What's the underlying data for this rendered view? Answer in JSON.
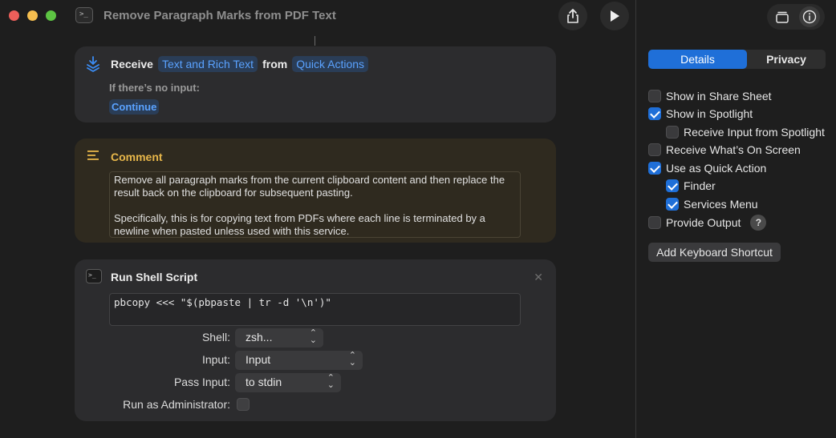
{
  "window": {
    "title": "Remove Paragraph Marks from PDF Text"
  },
  "receive": {
    "label": "Receive",
    "input_type": "Text and Rich Text",
    "from_label": "from",
    "source": "Quick Actions",
    "no_input_label": "If there’s no input:",
    "no_input_action": "Continue"
  },
  "comment": {
    "title": "Comment",
    "paragraph1": "Remove all paragraph marks from the current clipboard content and then replace the result back on the clipboard for subsequent pasting.",
    "paragraph2": "Specifically, this is for copying text from PDFs where each line is terminated by a newline when pasted unless used with this service."
  },
  "shell": {
    "title": "Run Shell Script",
    "script": "pbcopy <<< \"$(pbpaste | tr -d '\\n')\"",
    "shell_label": "Shell:",
    "shell_value": "zsh...",
    "input_label": "Input:",
    "input_value": "Input",
    "pass_input_label": "Pass Input:",
    "pass_input_value": "to stdin",
    "admin_label": "Run as Administrator:",
    "admin_checked": false
  },
  "sidebar": {
    "tabs": [
      "Details",
      "Privacy"
    ],
    "active_tab": "Details",
    "options": [
      {
        "label": "Show in Share Sheet",
        "checked": false
      },
      {
        "label": "Show in Spotlight",
        "checked": true
      },
      {
        "label": "Receive Input from Spotlight",
        "checked": false
      },
      {
        "label": "Receive What’s On Screen",
        "checked": false
      },
      {
        "label": "Use as Quick Action",
        "checked": true
      },
      {
        "label": "Finder",
        "checked": true
      },
      {
        "label": "Services Menu",
        "checked": true
      },
      {
        "label": "Provide Output",
        "checked": false
      }
    ],
    "help_glyph": "?",
    "keyboard_shortcut_button": "Add Keyboard Shortcut"
  },
  "colors": {
    "accent": "#1f6fd8",
    "token_text": "#5aa2ff",
    "comment_title": "#e8b74a"
  },
  "icons": [
    "terminal-icon",
    "share-icon",
    "play-icon",
    "receive-icon",
    "comment-icon",
    "close-icon",
    "chevron-updown-icon",
    "library-icon",
    "info-icon"
  ]
}
